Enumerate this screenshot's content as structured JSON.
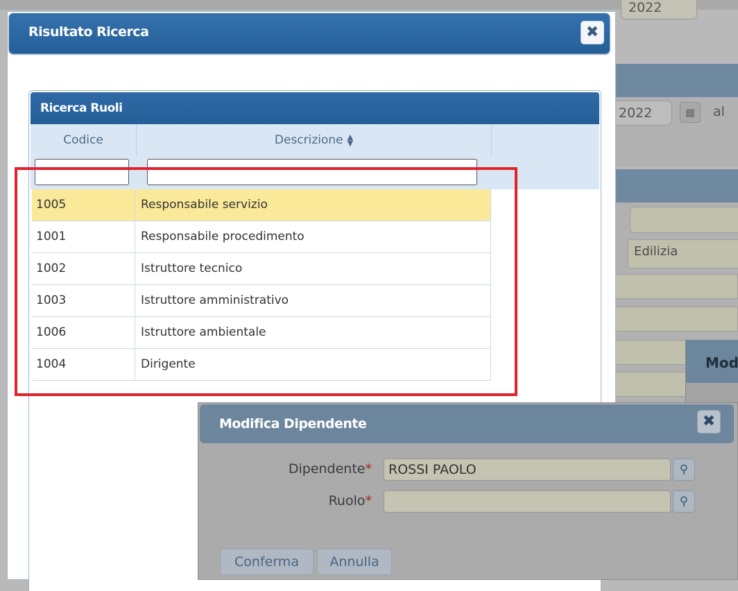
{
  "background": {
    "top_field_value": "2022",
    "date_field_value": "2022",
    "calendar_icon": "calendar-icon",
    "date_to_label": "al",
    "field_value": "Edilizia",
    "partial_dialog_title": "Mod"
  },
  "results_dialog": {
    "title": "Risultato Ricerca",
    "close_icon": "close-icon",
    "grid": {
      "caption": "Ricerca Ruoli",
      "columns": {
        "code": "Codice",
        "description": "Descrizione"
      },
      "sort_icon": "sort-icon",
      "filters": {
        "code": "",
        "description": ""
      },
      "rows": [
        {
          "code": "1005",
          "description": "Responsabile servizio"
        },
        {
          "code": "1001",
          "description": "Responsabile procedimento"
        },
        {
          "code": "1002",
          "description": "Istruttore tecnico"
        },
        {
          "code": "1003",
          "description": "Istruttore amministrativo"
        },
        {
          "code": "1006",
          "description": "Istruttore ambientale"
        },
        {
          "code": "1004",
          "description": "Dirigente"
        }
      ]
    },
    "highlight_color": "#e2222b"
  },
  "edit_dialog": {
    "title": "Modifica Dipendente",
    "close_icon": "close-icon",
    "employee_label": "Dipendente",
    "employee_value": "ROSSI PAOLO",
    "role_label": "Ruolo",
    "role_value": "",
    "required_mark": "*",
    "search_icon": "search-icon",
    "confirm_label": "Conferma",
    "cancel_label": "Annulla"
  }
}
